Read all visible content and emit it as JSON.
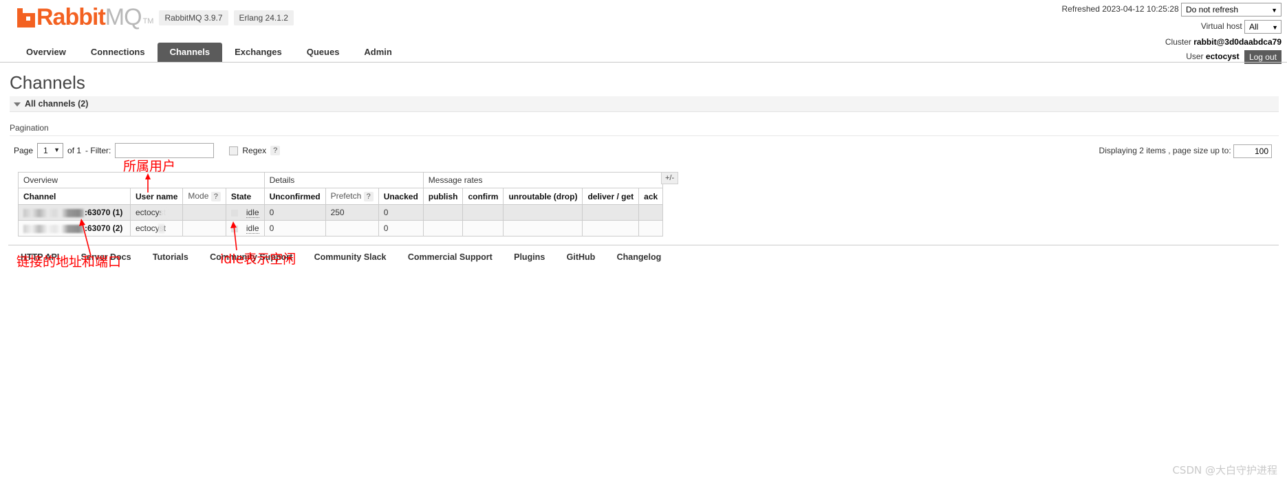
{
  "header": {
    "logo_rabbit": "Rabbit",
    "logo_mq": "MQ",
    "logo_tm": "TM",
    "version_rabbitmq": "RabbitMQ 3.9.7",
    "version_erlang": "Erlang 24.1.2",
    "refreshed_label": "Refreshed 2023-04-12 10:25:28",
    "refresh_select_value": "Do not refresh",
    "virtual_host_label": "Virtual host",
    "virtual_host_value": "All",
    "cluster_label": "Cluster",
    "cluster_value": "rabbit@3d0daabdca79",
    "user_label": "User",
    "user_value": "ectocyst",
    "logout_label": "Log out"
  },
  "nav": {
    "items": [
      {
        "label": "Overview",
        "active": false
      },
      {
        "label": "Connections",
        "active": false
      },
      {
        "label": "Channels",
        "active": true
      },
      {
        "label": "Exchanges",
        "active": false
      },
      {
        "label": "Queues",
        "active": false
      },
      {
        "label": "Admin",
        "active": false
      }
    ]
  },
  "page": {
    "title": "Channels",
    "section_label": "All channels (2)",
    "pagination_label": "Pagination"
  },
  "pagination": {
    "page_label": "Page",
    "page_value": "1",
    "of_label": "of 1",
    "filter_label": "- Filter:",
    "filter_value": "",
    "regex_label": "Regex",
    "help_mark": "?",
    "displaying_text": "Displaying 2 items , page size up to:",
    "page_size_value": "100"
  },
  "table": {
    "group_headers": [
      {
        "label": "Overview",
        "span": 4
      },
      {
        "label": "Details",
        "span": 3
      },
      {
        "label": "Message rates",
        "span": 5
      }
    ],
    "columns": [
      {
        "label": "Channel",
        "bold": true,
        "help": false
      },
      {
        "label": "User name",
        "bold": true,
        "help": false
      },
      {
        "label": "Mode",
        "bold": false,
        "help": true
      },
      {
        "label": "State",
        "bold": true,
        "help": false
      },
      {
        "label": "Unconfirmed",
        "bold": true,
        "help": false
      },
      {
        "label": "Prefetch",
        "bold": false,
        "help": true
      },
      {
        "label": "Unacked",
        "bold": true,
        "help": false
      },
      {
        "label": "publish",
        "bold": true,
        "help": false
      },
      {
        "label": "confirm",
        "bold": true,
        "help": false
      },
      {
        "label": "unroutable (drop)",
        "bold": true,
        "help": false
      },
      {
        "label": "deliver / get",
        "bold": true,
        "help": false
      },
      {
        "label": "ack",
        "bold": true,
        "help": false
      }
    ],
    "help_mark": "?",
    "plus_minus_label": "+/-",
    "rows": [
      {
        "channel": ":63070 (1)",
        "user_name": "ectocyst",
        "mode": "",
        "state": "idle",
        "unconfirmed": "0",
        "prefetch": "250",
        "unacked": "0",
        "publish": "",
        "confirm": "",
        "unroutable": "",
        "deliver_get": "",
        "ack": ""
      },
      {
        "channel": ":63070 (2)",
        "user_name": "ectocyst",
        "mode": "",
        "state": "idle",
        "unconfirmed": "0",
        "prefetch": "",
        "unacked": "0",
        "publish": "",
        "confirm": "",
        "unroutable": "",
        "deliver_get": "",
        "ack": ""
      }
    ]
  },
  "footer": {
    "links": [
      "HTTP API",
      "Server Docs",
      "Tutorials",
      "Community Support",
      "Community Slack",
      "Commercial Support",
      "Plugins",
      "GitHub",
      "Changelog"
    ]
  },
  "annotations": {
    "user_note": "所属用户",
    "address_note": "链接的地址和端口",
    "idle_note": "idle表示空闲"
  },
  "watermark": "CSDN @大白守护进程"
}
